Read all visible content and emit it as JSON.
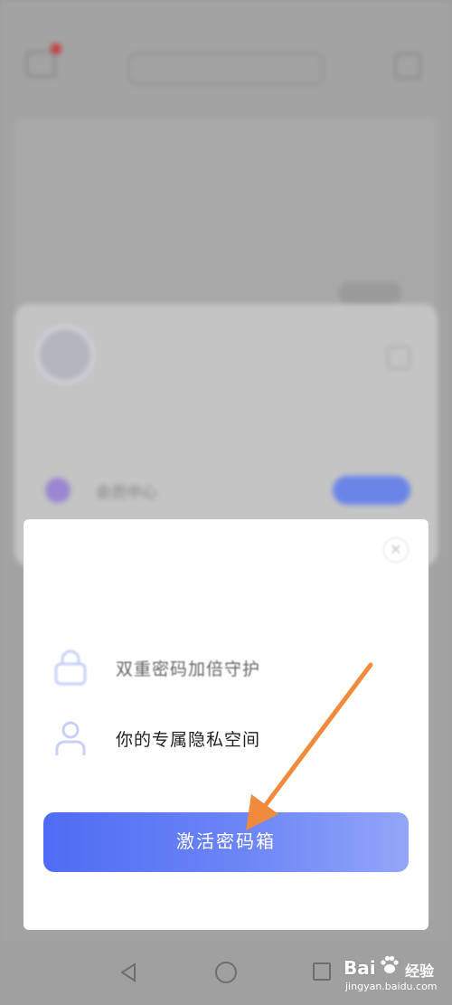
{
  "status_bar": {
    "left_text": "",
    "right_text": ""
  },
  "background_app": {
    "search_placeholder": "",
    "card": {
      "tag": "",
      "action": "",
      "title": "",
      "subtitle": ""
    },
    "sheet": {
      "description": "",
      "link": "",
      "vip_label": "会员中心",
      "vip_button": ""
    }
  },
  "modal": {
    "close_symbol": "✕",
    "title": "",
    "features": [
      {
        "icon": "lock-icon",
        "text": "双重密码加倍守护"
      },
      {
        "icon": "person-icon",
        "text": "你的专属隐私空间"
      }
    ],
    "activate_label": "激活密码箱"
  },
  "watermark": {
    "brand": "Bai",
    "suffix": "经验",
    "domain": "jingyan.baidu.com"
  },
  "colors": {
    "accent": "#5470f5",
    "annotation_arrow": "#f08a3c",
    "icon_light": "#c7d0f7"
  }
}
